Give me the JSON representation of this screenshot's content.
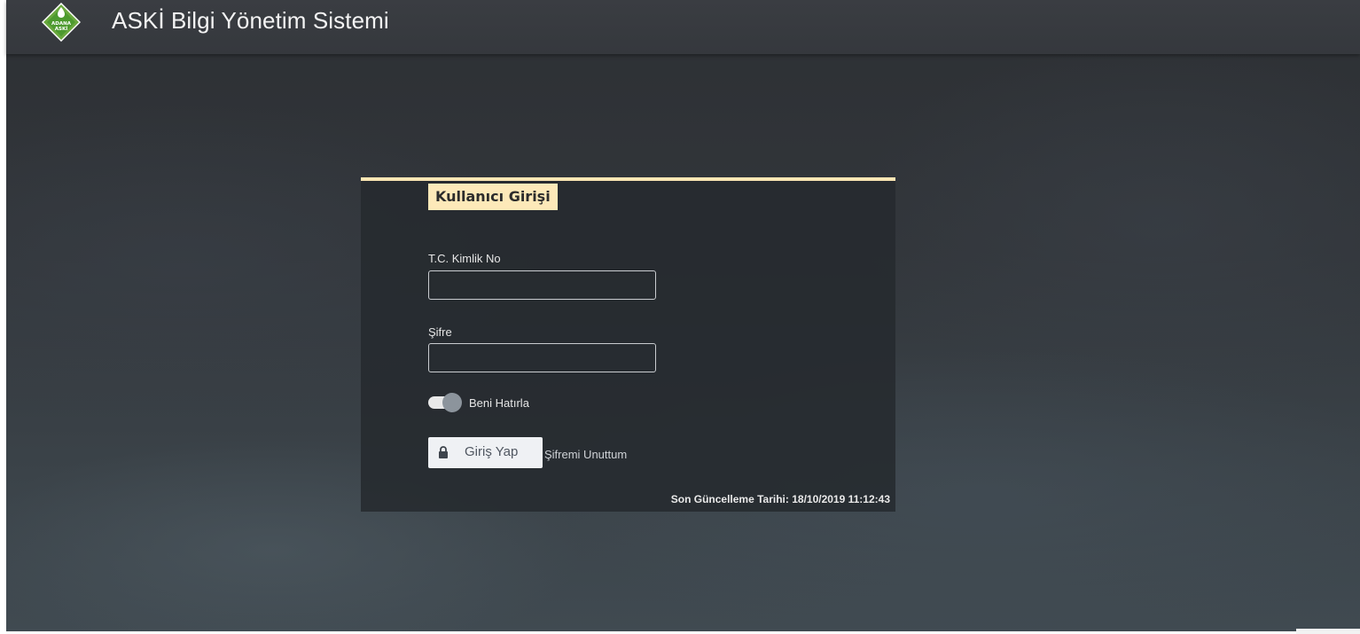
{
  "header": {
    "logo_text_line1": "ADANA",
    "logo_text_line2": "ASKİ",
    "title": "ASKİ Bilgi Yönetim Sistemi"
  },
  "login_form": {
    "tab_title": "Kullanıcı Girişi",
    "tc_label": "T.C. Kimlik No",
    "tc_value": "",
    "tc_placeholder": "",
    "password_label": "Şifre",
    "password_value": "",
    "password_placeholder": "",
    "remember_label": "Beni Hatırla",
    "remember_checked": true,
    "login_button_label": "Giriş Yap",
    "forgot_link": "Şifremi Unuttum",
    "last_update": "Son Güncelleme Tarihi: 18/10/2019 11:12:43"
  },
  "icons": {
    "logo": "aski-logo-icon",
    "lock": "lock-icon"
  },
  "colors": {
    "accent": "#fde9b9",
    "header_bg": "#37393e",
    "logo_green": "#5ea83a"
  }
}
